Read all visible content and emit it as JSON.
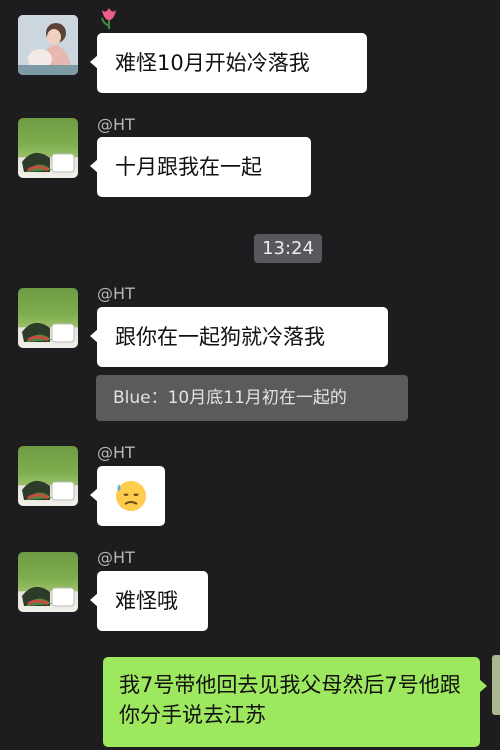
{
  "messages": {
    "m1": {
      "text": "难怪10月开始冷落我"
    },
    "m2": {
      "nick": "@HT",
      "text": "十月跟我在一起"
    },
    "timestamp": "13:24",
    "m3": {
      "nick": "@HT",
      "text": "跟你在一起狗就冷落我",
      "quote": "Blue：10月底11月初在一起的"
    },
    "m4": {
      "nick": "@HT",
      "emoji": "sweat-face"
    },
    "m5": {
      "nick": "@HT",
      "text": "难怪哦"
    },
    "m6": {
      "text": "我7号带他回去见我父母然后7号他跟你分手说去江苏"
    }
  },
  "colors": {
    "background": "#1d1d20",
    "incoming_bubble": "#ffffff",
    "outgoing_bubble": "#9ee85f",
    "timestamp_bg": "#58585c",
    "quote_bg": "#5b5b5e"
  },
  "icons": {
    "flower": "tulip-icon",
    "avatar_a": "girl-photo-avatar",
    "avatar_b": "grass-watermelon-avatar"
  }
}
